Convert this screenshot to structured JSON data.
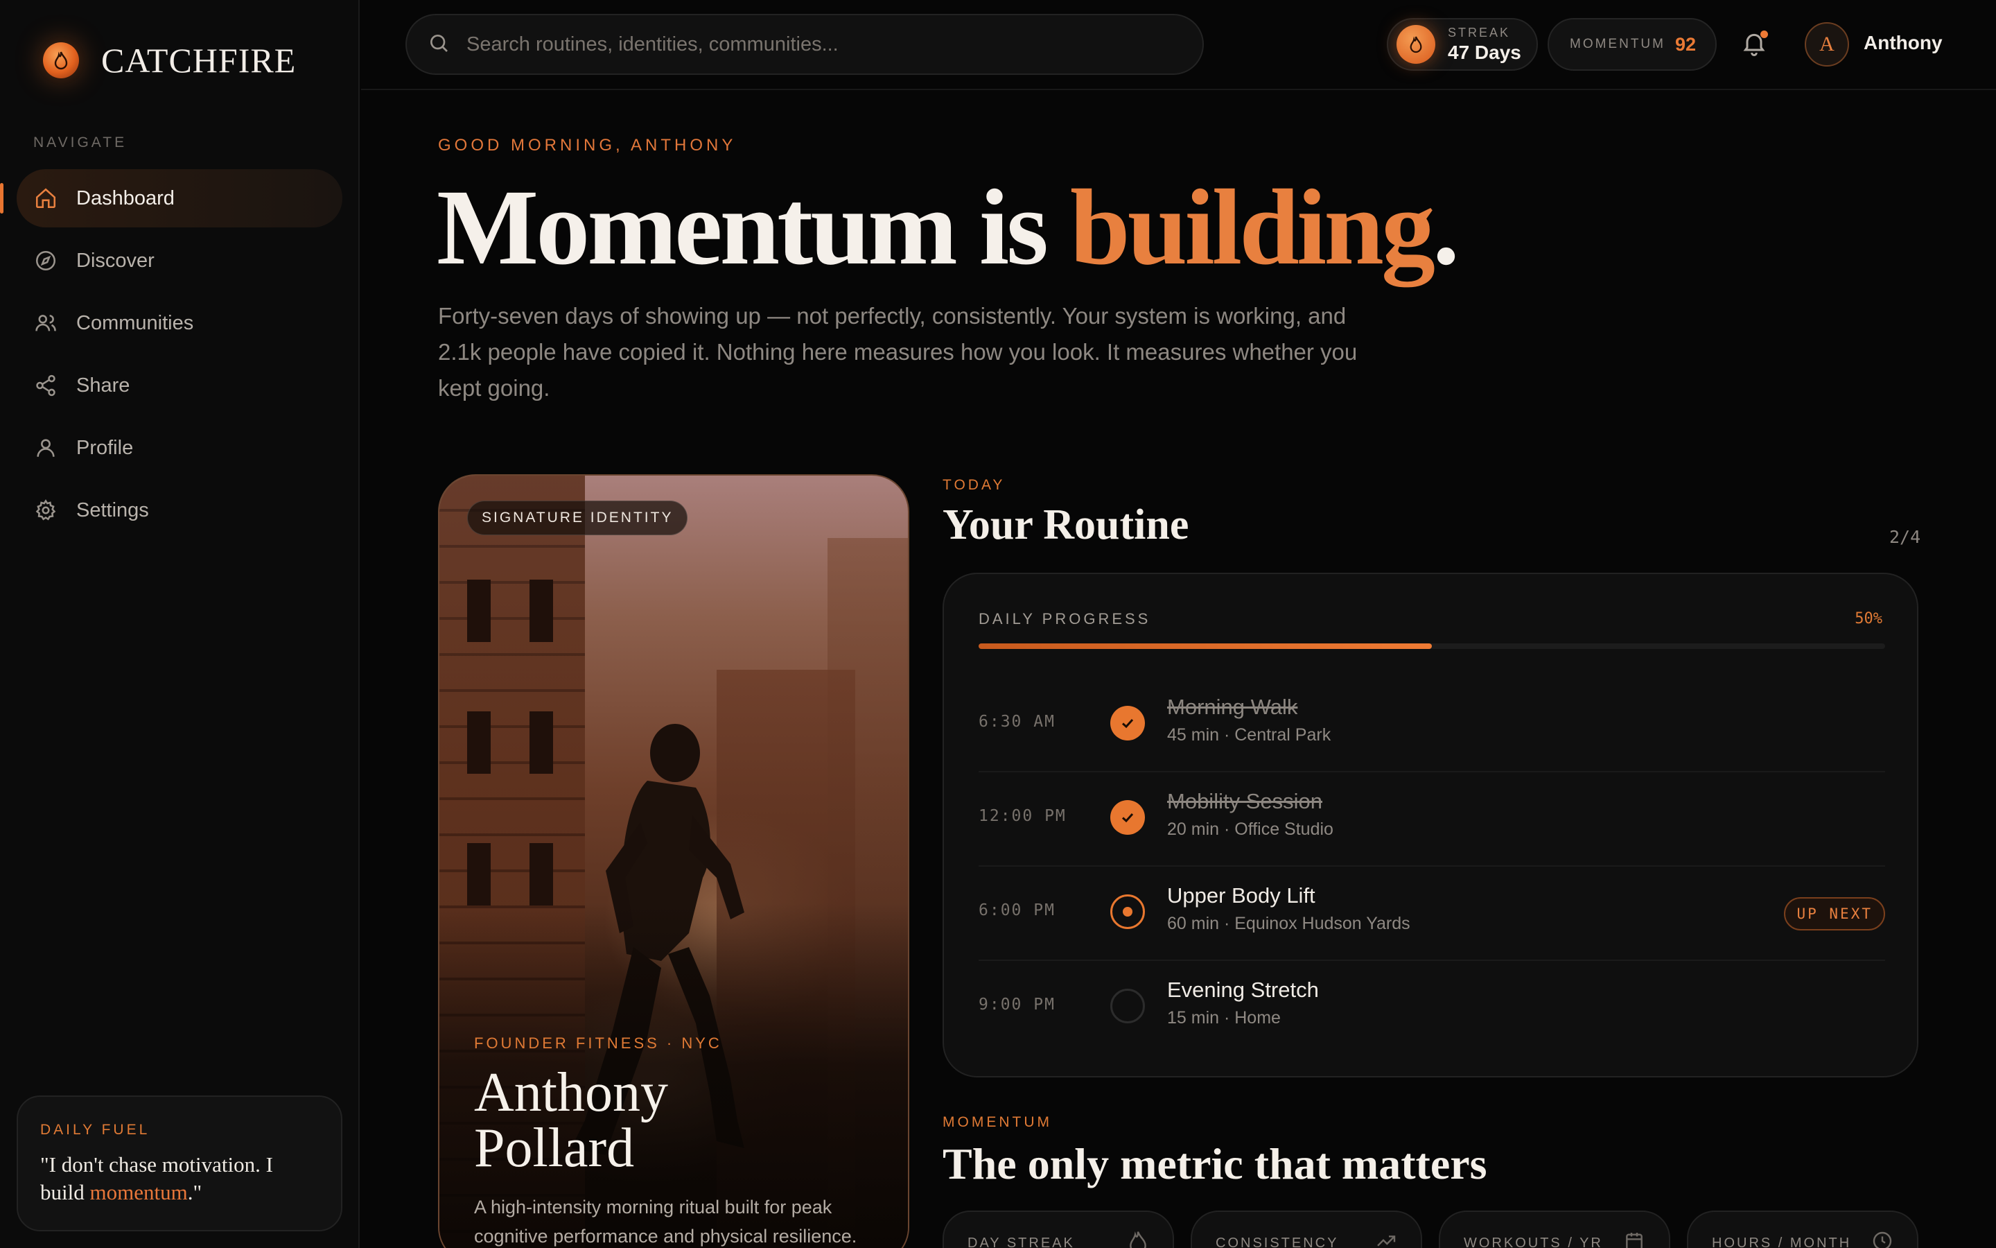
{
  "brand": {
    "name": "CATCHFIRE",
    "logo_icon": "flame-icon"
  },
  "sidebar": {
    "caption": "NAVIGATE",
    "items": [
      {
        "label": "Dashboard",
        "icon": "home-icon",
        "active": true
      },
      {
        "label": "Discover",
        "icon": "compass-icon"
      },
      {
        "label": "Communities",
        "icon": "users-icon"
      },
      {
        "label": "Share",
        "icon": "share-icon"
      },
      {
        "label": "Profile",
        "icon": "user-icon"
      },
      {
        "label": "Settings",
        "icon": "gear-icon"
      }
    ],
    "fuel": {
      "caption": "DAILY FUEL",
      "quote_before": "\"I don't chase motivation. I build ",
      "quote_highlight": "momentum",
      "quote_after": ".\""
    }
  },
  "topbar": {
    "search_placeholder": "Search routines, identities, communities...",
    "streak": {
      "caption": "STREAK",
      "value": "47 Days"
    },
    "momentum": {
      "caption": "MOMENTUM",
      "value": "92"
    },
    "user": {
      "initial": "A",
      "name": "Anthony"
    }
  },
  "hero": {
    "greeting": "GOOD MORNING, ANTHONY",
    "headline_start": "Momentum is ",
    "headline_accent": "building",
    "headline_end": ".",
    "subtext": "Forty-seven days of showing up — not perfectly, consistently. Your system is working, and 2.1k people have copied it. Nothing here measures how you look. It measures whether you kept going."
  },
  "identity_card": {
    "badge": "SIGNATURE IDENTITY",
    "category": "FOUNDER FITNESS · NYC",
    "name_line1": "Anthony",
    "name_line2": "Pollard",
    "description": "A high-intensity morning ritual built for peak cognitive performance and physical resilience."
  },
  "routine": {
    "caption": "TODAY",
    "title": "Your Routine",
    "count": "2/4",
    "progress_caption": "DAILY PROGRESS",
    "progress_label": "50%",
    "progress_fraction": 0.5,
    "tasks": [
      {
        "time": "6:30 AM",
        "title": "Morning Walk",
        "detail": "45 min · Central Park",
        "status": "done"
      },
      {
        "time": "12:00 PM",
        "title": "Mobility Session",
        "detail": "20 min · Office Studio",
        "status": "done"
      },
      {
        "time": "6:00 PM",
        "title": "Upper Body Lift",
        "detail": "60 min · Equinox Hudson Yards",
        "status": "next",
        "badge": "UP NEXT"
      },
      {
        "time": "9:00 PM",
        "title": "Evening Stretch",
        "detail": "15 min · Home",
        "status": "todo"
      }
    ]
  },
  "momentum": {
    "caption": "MOMENTUM",
    "title": "The only metric that matters",
    "stats": [
      {
        "label": "DAY STREAK",
        "icon": "flame-icon"
      },
      {
        "label": "CONSISTENCY",
        "icon": "trend-up-icon"
      },
      {
        "label": "WORKOUTS / YR",
        "icon": "calendar-icon"
      },
      {
        "label": "HOURS / MONTH",
        "icon": "clock-icon"
      }
    ]
  },
  "colors": {
    "accent": "#e8772f",
    "background": "#060606",
    "panel": "#0f0f0f"
  }
}
